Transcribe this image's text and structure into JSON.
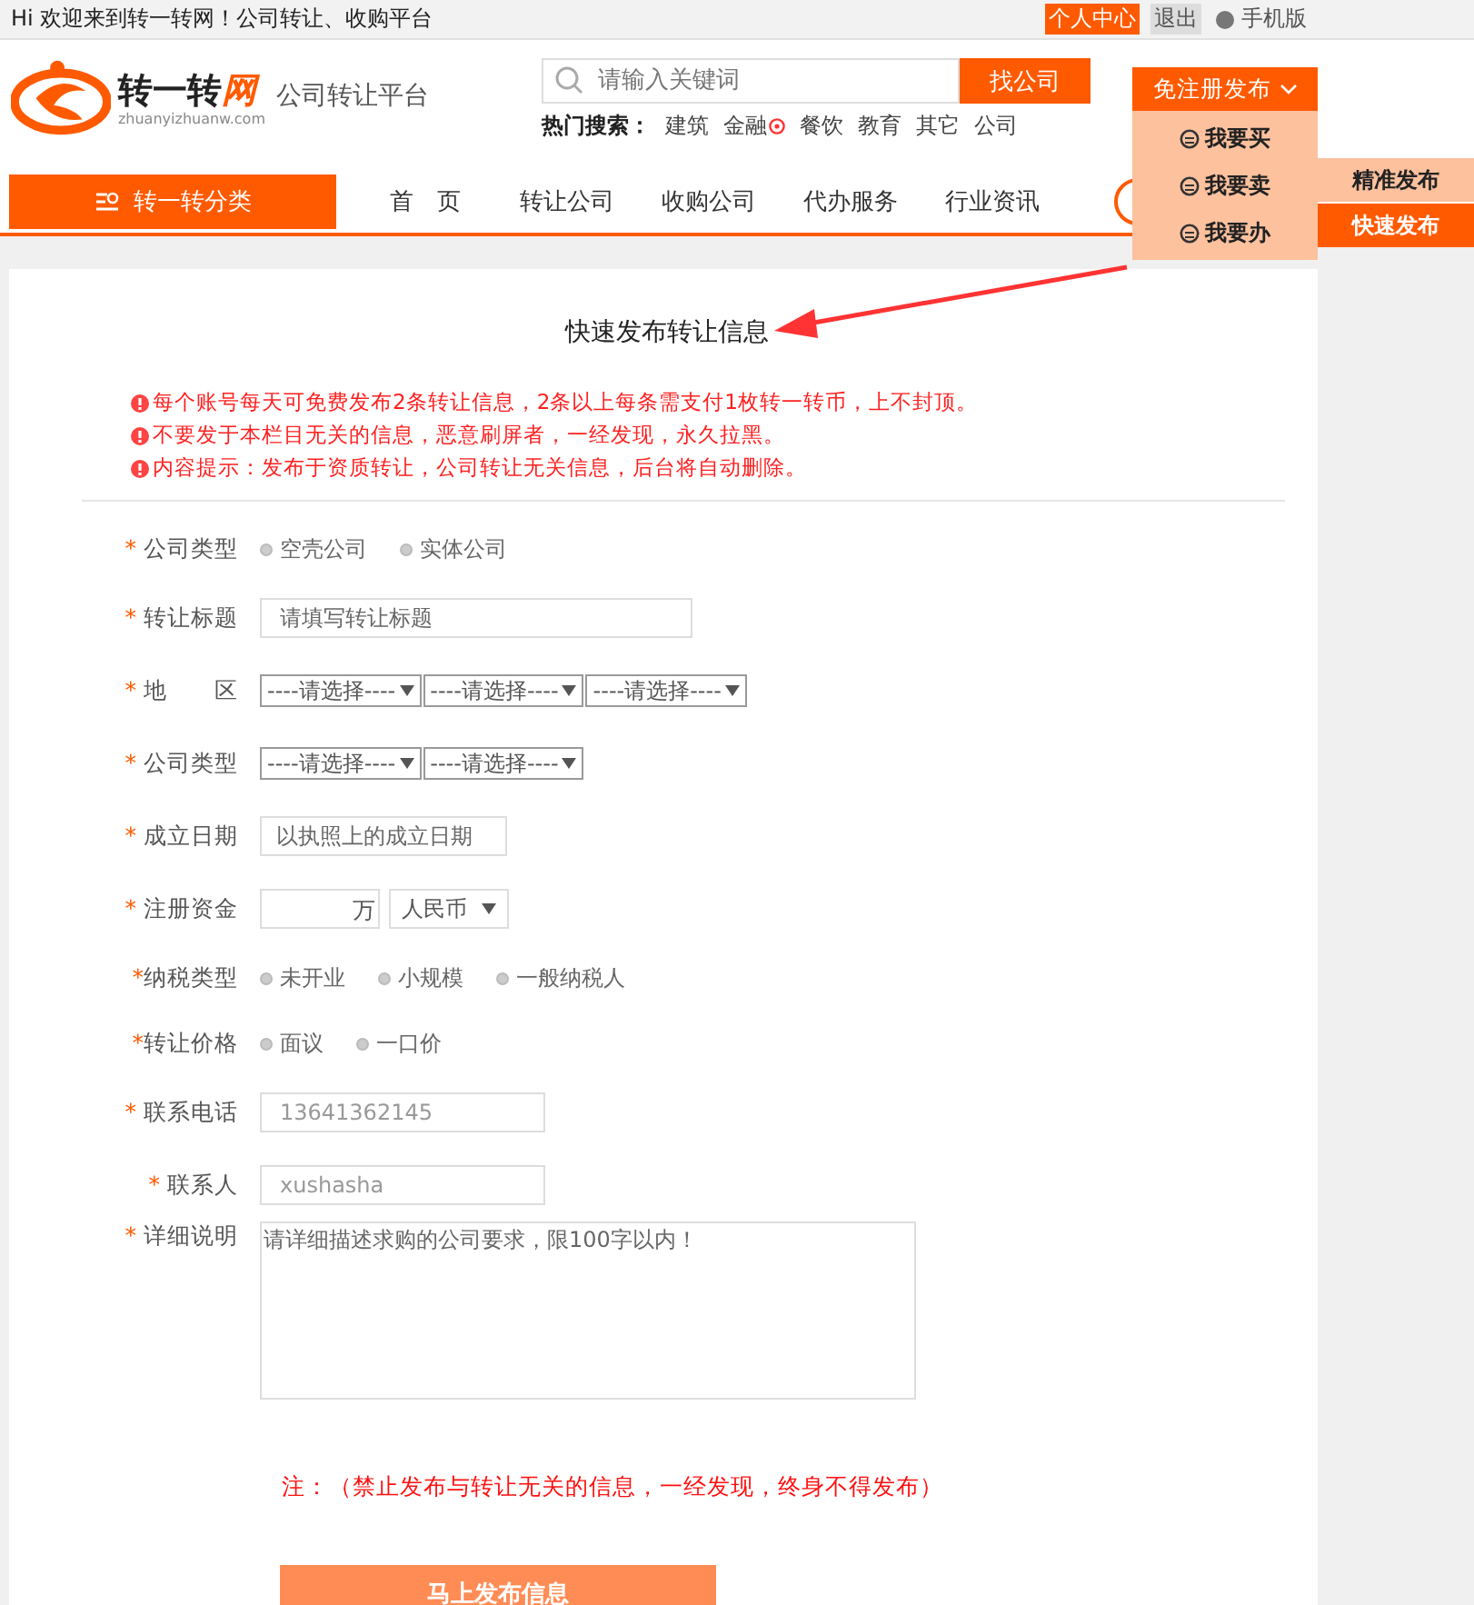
{
  "top_bar": {
    "welcome": "Hi 欢迎来到转一转网！公司转让、收购平台",
    "links": [
      {
        "kind": "primary",
        "label": "个人中心"
      },
      {
        "kind": "muted",
        "label": "退出"
      },
      {
        "kind": "mobile",
        "label": "手机版"
      }
    ]
  },
  "header": {
    "logo": {
      "name_main": "转一转",
      "name_accent": "网",
      "domain": "zhuanyizhuanw.com"
    },
    "slogan": "公司转让平台",
    "search": {
      "placeholder": "请输入关键词",
      "button": "找公司"
    },
    "hot": {
      "label": "热门搜索：",
      "items": [
        {
          "label": "建筑",
          "badge": false
        },
        {
          "label": "金融",
          "badge": true
        },
        {
          "label": "餐饮",
          "badge": false
        },
        {
          "label": "教育",
          "badge": false
        },
        {
          "label": "其它",
          "badge": false
        },
        {
          "label": "公司",
          "badge": false
        }
      ]
    }
  },
  "publish_menu": {
    "button": "免注册发布",
    "items": [
      {
        "label": "我要买"
      },
      {
        "label": "我要卖"
      },
      {
        "label": "我要办"
      }
    ],
    "submenu": [
      {
        "label": "精准发布",
        "selected": false
      },
      {
        "label": "快速发布",
        "selected": true
      }
    ]
  },
  "nav": {
    "category": "转一转分类",
    "items": [
      "首　页",
      "转让公司",
      "收购公司",
      "代办服务",
      "行业资讯"
    ]
  },
  "form": {
    "title": "快速发布转让信息",
    "notices": [
      "每个账号每天可免费发布2条转让信息，2条以上每条需支付1枚转一转币，上不封顶。",
      "不要发于本栏目无关的信息，恶意刷屏者，一经发现，永久拉黑。",
      "内容提示：发布于资质转让，公司转让无关信息，后台将自动删除。"
    ],
    "rows": [
      {
        "mark": "* ",
        "label": "公司类型",
        "kind": "radio",
        "options": [
          {
            "label": "空壳公司",
            "selected": false
          },
          {
            "label": "实体公司",
            "selected": false
          }
        ]
      },
      {
        "mark": "* ",
        "label": "转让标题",
        "kind": "text",
        "placeholder": "请填写转让标题"
      },
      {
        "mark": "* ",
        "label": "地　　区",
        "kind": "select",
        "selects": [
          "----请选择----",
          "----请选择----",
          "----请选择----"
        ]
      },
      {
        "mark": "* ",
        "label": "公司类型",
        "kind": "select",
        "selects": [
          "----请选择----",
          "----请选择----"
        ]
      },
      {
        "mark": "* ",
        "label": "成立日期",
        "kind": "date",
        "placeholder": "以执照上的成立日期"
      },
      {
        "mark": "* ",
        "label": "注册资金",
        "kind": "money",
        "unit": "万",
        "currency": "人民币"
      },
      {
        "mark": "*",
        "label": "纳税类型",
        "kind": "radio",
        "options": [
          {
            "label": "未开业",
            "selected": false
          },
          {
            "label": "小规模",
            "selected": false
          },
          {
            "label": "一般纳税人",
            "selected": false
          }
        ]
      },
      {
        "mark": "*",
        "label": "转让价格",
        "kind": "radio",
        "options": [
          {
            "label": "面议",
            "selected": false
          },
          {
            "label": "一口价",
            "selected": false
          }
        ]
      },
      {
        "mark": "* ",
        "label": "联系电话",
        "kind": "text",
        "value": "13641362145"
      },
      {
        "mark": "* ",
        "label": "联系人",
        "kind": "text",
        "value": "xushasha"
      },
      {
        "mark": "* ",
        "label": "详细说明",
        "kind": "textarea",
        "placeholder": "请详细描述求购的公司要求，限100字以内！"
      }
    ],
    "note": "注：（禁止发布与转让无关的信息，一经发现，终身不得发布）",
    "submit": "马上发布信息"
  }
}
